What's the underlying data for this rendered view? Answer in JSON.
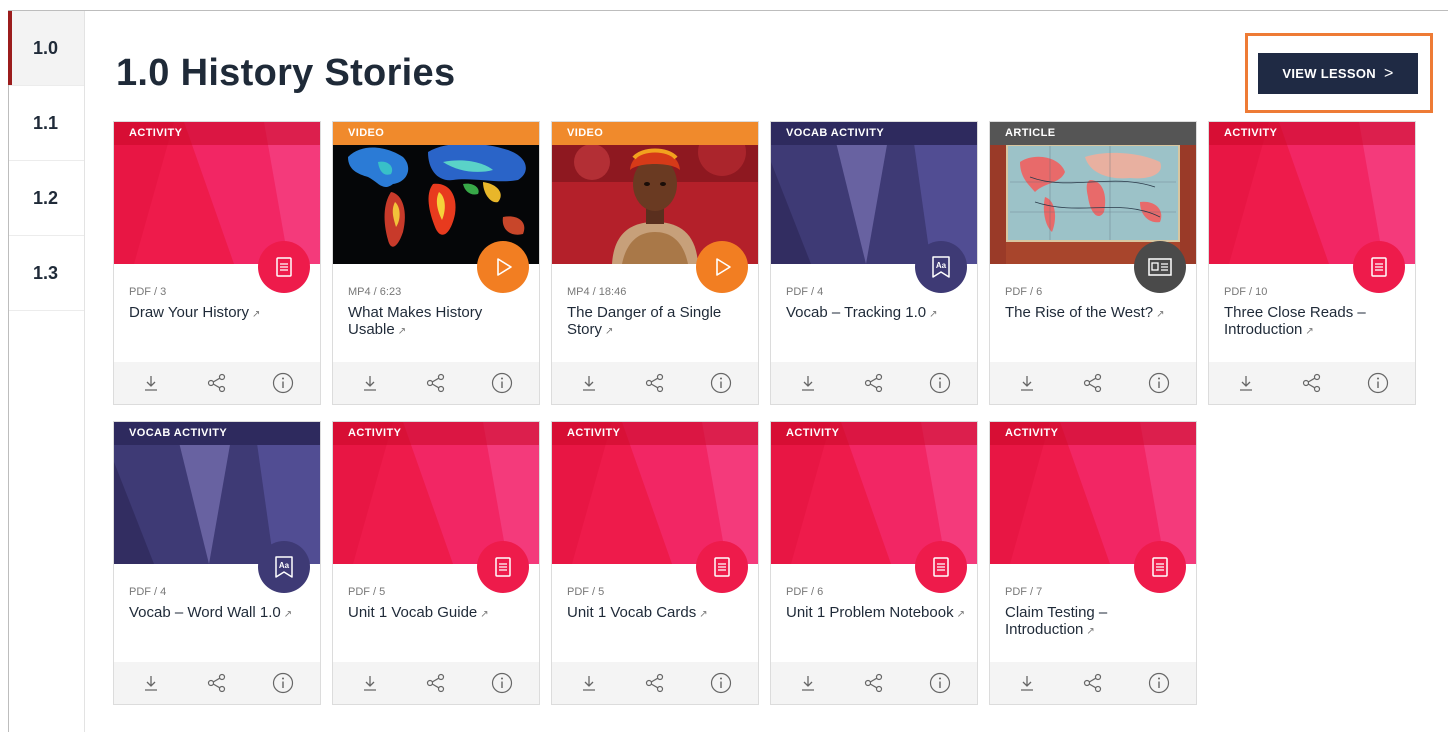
{
  "sidebar": {
    "items": [
      {
        "label": "1.0",
        "active": true
      },
      {
        "label": "1.1",
        "active": false
      },
      {
        "label": "1.2",
        "active": false
      },
      {
        "label": "1.3",
        "active": false
      }
    ]
  },
  "header": {
    "title": "1.0 History Stories",
    "view_lesson_label": "VIEW LESSON",
    "view_lesson_chevron": ">"
  },
  "colors": {
    "activity": "#ee1b4b",
    "video": "#f27e22",
    "vocab": "#3e3a75",
    "article": "#4a4a4a",
    "highlight": "#ee7b35",
    "button": "#1f2a44"
  },
  "cards": [
    {
      "tag": "ACTIVITY",
      "kind": "activity",
      "thumb": "activity",
      "meta": "PDF / 3",
      "title": "Draw Your History",
      "badge_icon": "document-icon"
    },
    {
      "tag": "VIDEO",
      "kind": "video",
      "thumb": "map",
      "meta": "MP4 / 6:23",
      "title": "What Makes History Usable",
      "badge_icon": "play-icon"
    },
    {
      "tag": "VIDEO",
      "kind": "video",
      "thumb": "speaker",
      "meta": "MP4 / 18:46",
      "title": "The Danger of a Single Story",
      "badge_icon": "play-icon"
    },
    {
      "tag": "VOCAB ACTIVITY",
      "kind": "vocab",
      "thumb": "vocab",
      "meta": "PDF / 4",
      "title": "Vocab – Tracking 1.0",
      "badge_icon": "vocab-bookmark-icon"
    },
    {
      "tag": "ARTICLE",
      "kind": "article",
      "thumb": "oldmap",
      "meta": "PDF / 6",
      "title": "The Rise of the West?",
      "badge_icon": "article-icon"
    },
    {
      "tag": "ACTIVITY",
      "kind": "activity",
      "thumb": "activity",
      "meta": "PDF / 10",
      "title": "Three Close Reads – Introduction",
      "badge_icon": "document-icon"
    },
    {
      "tag": "VOCAB ACTIVITY",
      "kind": "vocab",
      "thumb": "vocab",
      "meta": "PDF / 4",
      "title": "Vocab – Word Wall 1.0",
      "badge_icon": "vocab-bookmark-icon"
    },
    {
      "tag": "ACTIVITY",
      "kind": "activity",
      "thumb": "activity",
      "meta": "PDF / 5",
      "title": "Unit 1 Vocab Guide",
      "badge_icon": "document-icon"
    },
    {
      "tag": "ACTIVITY",
      "kind": "activity",
      "thumb": "activity",
      "meta": "PDF / 5",
      "title": "Unit 1 Vocab Cards",
      "badge_icon": "document-icon"
    },
    {
      "tag": "ACTIVITY",
      "kind": "activity",
      "thumb": "activity",
      "meta": "PDF / 6",
      "title": "Unit 1 Problem Notebook",
      "badge_icon": "document-icon"
    },
    {
      "tag": "ACTIVITY",
      "kind": "activity",
      "thumb": "activity",
      "meta": "PDF / 7",
      "title": "Claim Testing – Introduction",
      "badge_icon": "document-icon"
    }
  ],
  "card_actions": [
    "download-icon",
    "share-icon",
    "info-icon"
  ]
}
